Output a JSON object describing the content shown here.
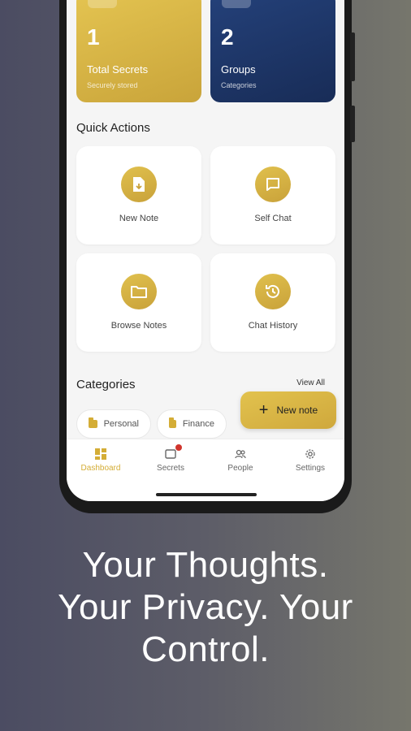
{
  "stats": [
    {
      "number": "1",
      "label": "Total Secrets",
      "sub": "Securely stored"
    },
    {
      "number": "2",
      "label": "Groups",
      "sub": "Categories"
    }
  ],
  "quick_actions": {
    "title": "Quick Actions",
    "items": [
      {
        "label": "New Note",
        "icon": "note-add-icon"
      },
      {
        "label": "Self Chat",
        "icon": "chat-bubble-icon"
      },
      {
        "label": "Browse Notes",
        "icon": "folder-icon"
      },
      {
        "label": "Chat History",
        "icon": "history-icon"
      }
    ]
  },
  "categories": {
    "title": "Categories",
    "view_all": "View All",
    "items": [
      {
        "label": "Personal",
        "icon": "folder-icon"
      },
      {
        "label": "Finance",
        "icon": "folder-icon"
      }
    ]
  },
  "fab": {
    "label": "New note",
    "icon": "plus-icon"
  },
  "nav": {
    "items": [
      {
        "label": "Dashboard",
        "icon": "dashboard-icon",
        "active": true
      },
      {
        "label": "Secrets",
        "icon": "secrets-icon",
        "badge": true
      },
      {
        "label": "People",
        "icon": "people-icon"
      },
      {
        "label": "Settings",
        "icon": "gear-icon"
      }
    ]
  },
  "headline": {
    "line1": "Your Thoughts.",
    "line2": "Your Privacy. Your",
    "line3": "Control."
  },
  "colors": {
    "accent": "#d4ad36",
    "navy": "#1f3a6d"
  }
}
